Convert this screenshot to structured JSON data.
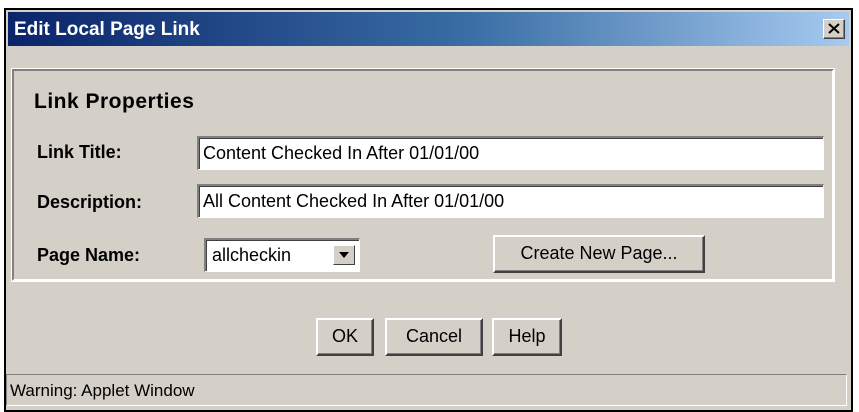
{
  "window": {
    "title": "Edit Local Page Link"
  },
  "link_properties": {
    "heading": "Link Properties",
    "link_title_label": "Link Title:",
    "link_title_value": "Content Checked In After 01/01/00",
    "description_label": "Description:",
    "description_value": "All Content Checked In After 01/01/00",
    "page_name_label": "Page Name:",
    "page_name_selected": "allcheckin",
    "create_new_page_label": "Create New Page..."
  },
  "buttons": {
    "ok": "OK",
    "cancel": "Cancel",
    "help": "Help"
  },
  "status": {
    "text": "Warning: Applet Window"
  },
  "colors": {
    "title_bar_start": "#0a246a",
    "title_bar_end": "#a6caf0",
    "dialog_background": "#d4d0c8"
  },
  "icons": {
    "close": "close-icon",
    "dropdown": "chevron-down-icon"
  }
}
